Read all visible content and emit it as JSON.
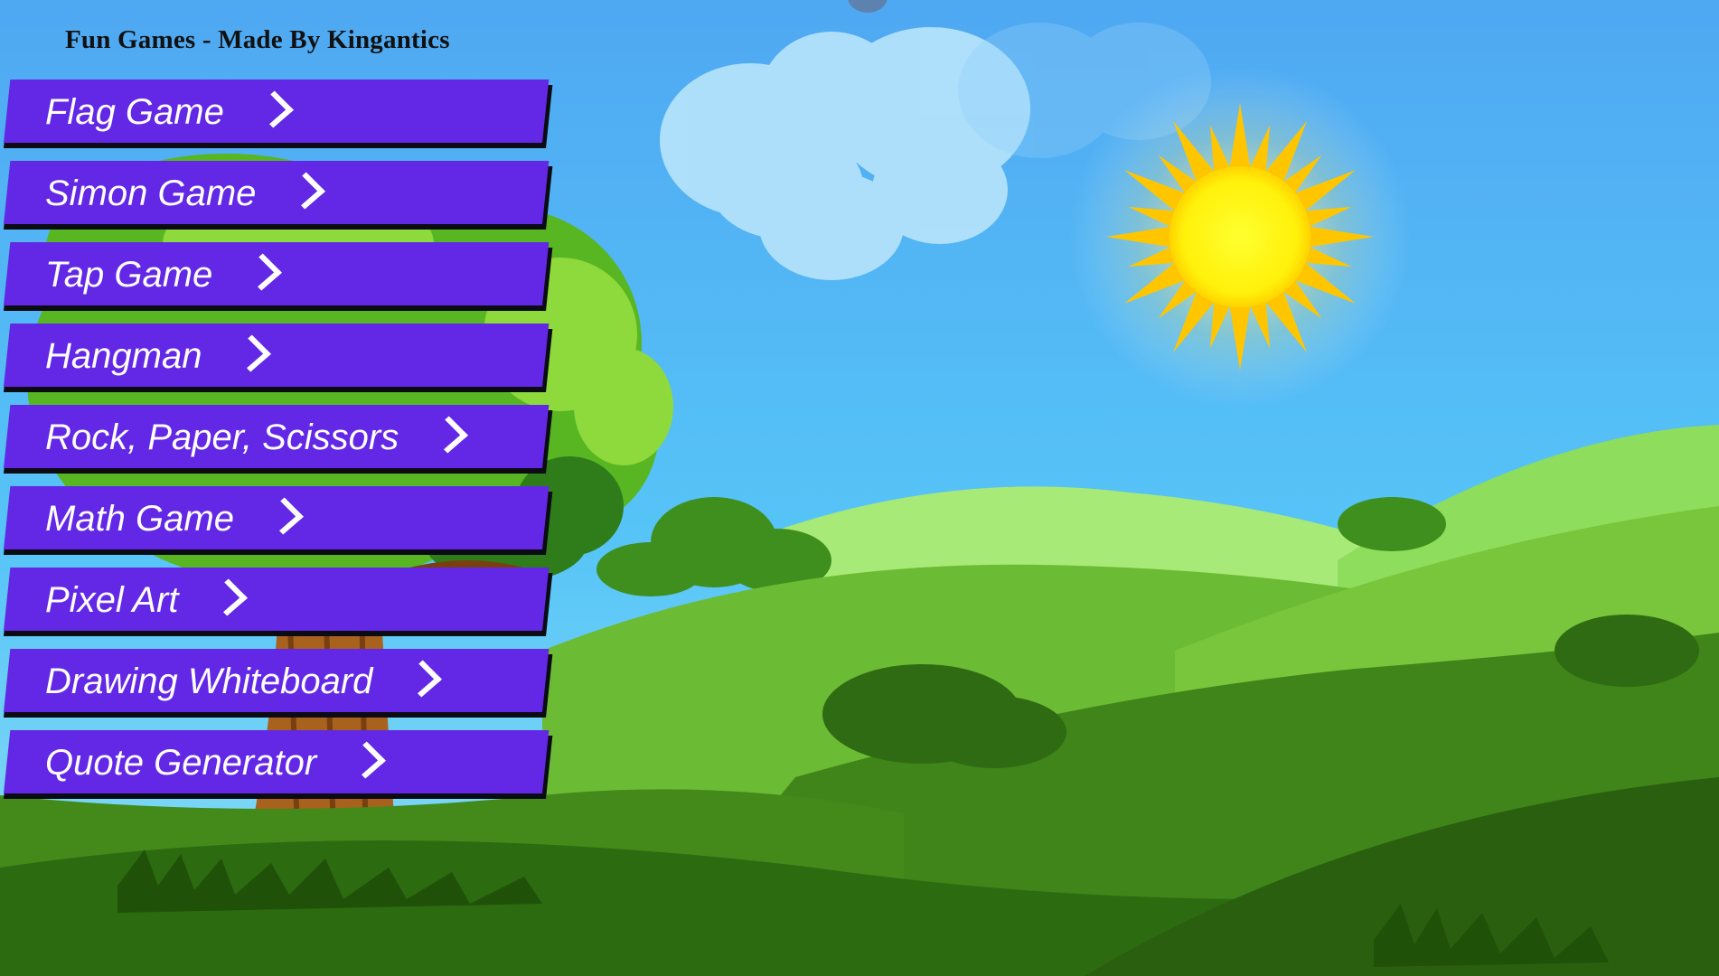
{
  "page": {
    "title": "Fun Games - Made By Kingantics"
  },
  "menu": {
    "items": [
      {
        "label": "Flag Game",
        "icon": "chevron-right-icon"
      },
      {
        "label": "Simon Game",
        "icon": "chevron-right-icon"
      },
      {
        "label": "Tap Game",
        "icon": "chevron-right-icon"
      },
      {
        "label": "Hangman",
        "icon": "chevron-right-icon"
      },
      {
        "label": "Rock, Paper, Scissors",
        "icon": "chevron-right-icon"
      },
      {
        "label": "Math Game",
        "icon": "chevron-right-icon"
      },
      {
        "label": "Pixel Art",
        "icon": "chevron-right-icon"
      },
      {
        "label": "Drawing Whiteboard",
        "icon": "chevron-right-icon"
      },
      {
        "label": "Quote Generator",
        "icon": "chevron-right-icon"
      }
    ]
  },
  "colors": {
    "button": "#6327e6",
    "button_shadow": "#0b0b14",
    "sky_top": "#4fa8f2",
    "sky_bottom": "#7fd8f8",
    "sun": "#ffd21a"
  }
}
